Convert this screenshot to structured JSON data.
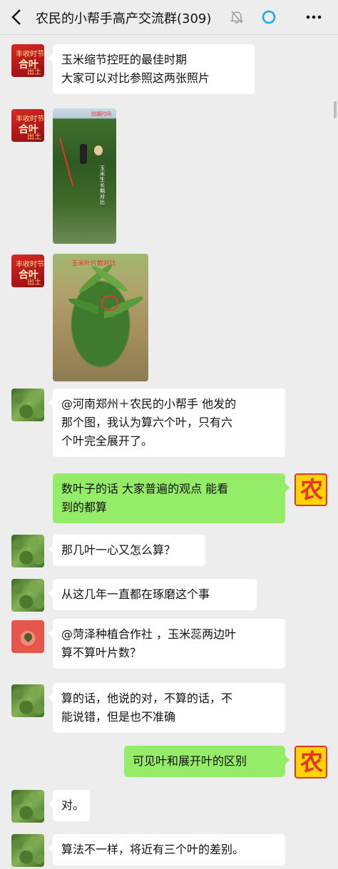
{
  "header": {
    "title": "农民的小帮手高产交流群(309)",
    "back_icon": "chevron-left-icon",
    "mute_icon": "bell-mute-icon",
    "ring_icon": "ring-icon",
    "more_icon": "more-dots-icon"
  },
  "avatars": {
    "book_text_1": "丰收时节",
    "book_text_2": "合叶",
    "book_text_3": "出土"
  },
  "messages": [
    {
      "lines": [
        "玉米缩节控旺的最佳时期",
        "大家可以对比参照这两张照片"
      ]
    },
    {
      "photo_label": "拍摄时间",
      "photo_vlabel": "玉米生长期对比"
    },
    {
      "photo_label": "玉米叶片数对比"
    },
    {
      "lines": [
        "@河南郑州＋农民的小帮手  他发的",
        "那个图，我认为算六个叶，只有六",
        "个叶完全展开了。"
      ]
    },
    {
      "lines": [
        "数叶子的话   大家普遍的观点  能看",
        "到的都算"
      ],
      "avatar_glyph": "农"
    },
    {
      "lines": [
        "那几叶一心又怎么算？"
      ]
    },
    {
      "lines": [
        "从这几年一直都在琢磨这个事"
      ]
    },
    {
      "lines": [
        "@菏泽种植合作社 ，玉米蕊两边叶",
        "算不算叶片数？"
      ]
    },
    {
      "lines": [
        "算的话，他说的对，不算的话，不",
        "能说错，但是也不准确"
      ]
    },
    {
      "lines": [
        "可见叶和展开叶的区别"
      ],
      "avatar_glyph": "农"
    },
    {
      "lines": [
        "对。"
      ]
    },
    {
      "lines": [
        "算法不一样，将近有三个叶的差别。"
      ]
    }
  ],
  "colors": {
    "background": "#ededed",
    "bubble_left": "#ffffff",
    "bubble_right": "#95ec69",
    "ring_accent": "#1aa7ec"
  }
}
